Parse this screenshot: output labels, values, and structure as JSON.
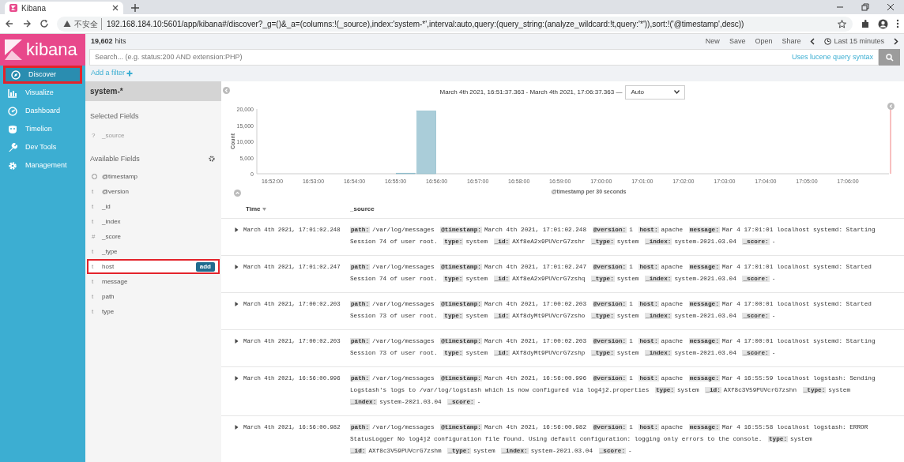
{
  "browser": {
    "tab_title": "Kibana",
    "security": "不安全",
    "url": "192.168.184.10:5601/app/kibana#/discover?_g=()&_a=(columns:!(_source),index:'system-*',interval:auto,query:(query_string:(analyze_wildcard:!t,query:'*')),sort:!('@timestamp',desc))"
  },
  "logo": "kibana",
  "nav": [
    {
      "label": "Discover",
      "selected": true,
      "highlighted": true
    },
    {
      "label": "Visualize",
      "selected": false,
      "highlighted": false
    },
    {
      "label": "Dashboard",
      "selected": false,
      "highlighted": false
    },
    {
      "label": "Timelion",
      "selected": false,
      "highlighted": false
    },
    {
      "label": "Dev Tools",
      "selected": false,
      "highlighted": false
    },
    {
      "label": "Management",
      "selected": false,
      "highlighted": false
    }
  ],
  "hits": "19,602",
  "hits_label": "hits",
  "menu": [
    "New",
    "Save",
    "Open",
    "Share"
  ],
  "time_range": "Last 15 minutes",
  "search": {
    "placeholder": "Search... (e.g. status:200 AND extension:PHP)",
    "syntax_link": "Uses lucene query syntax"
  },
  "add_filter": "Add a filter",
  "index_pattern": "system-*",
  "selected_fields_title": "Selected Fields",
  "selected_fields": [
    {
      "symbol": "?",
      "name": "_source"
    }
  ],
  "available_fields_title": "Available Fields",
  "available_fields": [
    {
      "name": "@timestamp",
      "highlighted": false
    },
    {
      "symbol": "t",
      "name": "@version",
      "highlighted": false
    },
    {
      "symbol": "t",
      "name": "_id",
      "highlighted": false
    },
    {
      "symbol": "t",
      "name": "_index",
      "highlighted": false
    },
    {
      "symbol": "#",
      "name": "_score",
      "highlighted": false
    },
    {
      "symbol": "t",
      "name": "_type",
      "highlighted": false
    },
    {
      "symbol": "t",
      "name": "host",
      "highlighted": true,
      "button": "add"
    },
    {
      "symbol": "t",
      "name": "message",
      "highlighted": false
    },
    {
      "symbol": "t",
      "name": "path",
      "highlighted": false
    },
    {
      "symbol": "t",
      "name": "type",
      "highlighted": false
    }
  ],
  "time_header": "March 4th 2021, 16:51:37.363 - March 4th 2021, 17:06:37.363 —",
  "interval": "Auto",
  "chart_data": {
    "type": "bar",
    "ylabel": "Count",
    "xlabel": "@timestamp per 30 seconds",
    "categories": [
      null,
      "16:52:00",
      null,
      "16:53:00",
      null,
      "16:54:00",
      null,
      "16:55:00",
      null,
      "16:56:00",
      null,
      "16:57:00",
      null,
      "16:58:00",
      null,
      "16:59:00",
      null,
      "17:00:00",
      null,
      "17:01:00",
      null,
      "17:02:00",
      null,
      "17:03:00",
      null,
      "17:04:00",
      null,
      "17:05:00",
      null,
      "17:06:00",
      null
    ],
    "values": [
      0,
      0,
      0,
      0,
      0,
      0,
      0,
      200,
      19400,
      0,
      0,
      0,
      0,
      0,
      0,
      0,
      0,
      0,
      0,
      0,
      0,
      0,
      0,
      0,
      0,
      0,
      0,
      0,
      0,
      0,
      0
    ],
    "ylim": [
      0,
      20000
    ],
    "yticks": [
      {
        "value": 0,
        "label": "0"
      },
      {
        "value": 5000,
        "label": "5,000"
      },
      {
        "value": 10000,
        "label": "10,000"
      },
      {
        "value": 15000,
        "label": "15,000"
      },
      {
        "value": 20000,
        "label": "20,000"
      }
    ]
  },
  "columns": [
    "Time",
    "_source"
  ],
  "rows": [
    {
      "time": "March 4th 2021, 17:01:02.248",
      "source": [
        {
          "key": "path:",
          "value": "/var/log/messages"
        },
        {
          "key": "@timestamp:",
          "value": "March 4th 2021, 17:01:02.248"
        },
        {
          "key": "@version:",
          "value": "1"
        },
        {
          "key": "host:",
          "value": "apache"
        },
        {
          "key": "message:",
          "value": "Mar 4 17:01:01 localhost systemd: Starting Session 74 of user root."
        },
        {
          "key": "type:",
          "value": "system"
        },
        {
          "key": "_id:",
          "value": "AXf8eA2x9PUVcrG7zshr"
        },
        {
          "key": "_type:",
          "value": "system"
        },
        {
          "key": "_index:",
          "value": "system-2021.03.04"
        },
        {
          "key": "_score:",
          "value": "-"
        }
      ]
    },
    {
      "time": "March 4th 2021, 17:01:02.247",
      "source": [
        {
          "key": "path:",
          "value": "/var/log/messages"
        },
        {
          "key": "@timestamp:",
          "value": "March 4th 2021, 17:01:02.247"
        },
        {
          "key": "@version:",
          "value": "1"
        },
        {
          "key": "host:",
          "value": "apache"
        },
        {
          "key": "message:",
          "value": "Mar 4 17:01:01 localhost systemd: Started Session 74 of user root."
        },
        {
          "key": "type:",
          "value": "system"
        },
        {
          "key": "_id:",
          "value": "AXf8eA2x9PUVcrG7zshq"
        },
        {
          "key": "_type:",
          "value": "system"
        },
        {
          "key": "_index:",
          "value": "system-2021.03.04"
        },
        {
          "key": "_score:",
          "value": "-"
        }
      ]
    },
    {
      "time": "March 4th 2021, 17:00:02.203",
      "source": [
        {
          "key": "path:",
          "value": "/var/log/messages"
        },
        {
          "key": "@timestamp:",
          "value": "March 4th 2021, 17:00:02.203"
        },
        {
          "key": "@version:",
          "value": "1"
        },
        {
          "key": "host:",
          "value": "apache"
        },
        {
          "key": "message:",
          "value": "Mar 4 17:00:01 localhost systemd: Started Session 73 of user root."
        },
        {
          "key": "type:",
          "value": "system"
        },
        {
          "key": "_id:",
          "value": "AXf8dyMt9PUVcrG7zsho"
        },
        {
          "key": "_type:",
          "value": "system"
        },
        {
          "key": "_index:",
          "value": "system-2021.03.04"
        },
        {
          "key": "_score:",
          "value": "-"
        }
      ]
    },
    {
      "time": "March 4th 2021, 17:00:02.203",
      "source": [
        {
          "key": "path:",
          "value": "/var/log/messages"
        },
        {
          "key": "@timestamp:",
          "value": "March 4th 2021, 17:00:02.203"
        },
        {
          "key": "@version:",
          "value": "1"
        },
        {
          "key": "host:",
          "value": "apache"
        },
        {
          "key": "message:",
          "value": "Mar 4 17:00:01 localhost systemd: Starting Session 73 of user root."
        },
        {
          "key": "type:",
          "value": "system"
        },
        {
          "key": "_id:",
          "value": "AXf8dyMt9PUVcrG7zshp"
        },
        {
          "key": "_type:",
          "value": "system"
        },
        {
          "key": "_index:",
          "value": "system-2021.03.04"
        },
        {
          "key": "_score:",
          "value": "-"
        }
      ]
    },
    {
      "time": "March 4th 2021, 16:56:00.996",
      "source": [
        {
          "key": "path:",
          "value": "/var/log/messages"
        },
        {
          "key": "@timestamp:",
          "value": "March 4th 2021, 16:56:00.996"
        },
        {
          "key": "@version:",
          "value": "1"
        },
        {
          "key": "host:",
          "value": "apache"
        },
        {
          "key": "message:",
          "value": "Mar 4 16:55:59 localhost logstash: Sending Logstash's logs to /var/log/logstash which is now configured via log4j2.properties"
        },
        {
          "key": "type:",
          "value": "system"
        },
        {
          "key": "_id:",
          "value": "AXf8c3V59PUVcrG7zshn"
        },
        {
          "key": "_type:",
          "value": "system"
        },
        {
          "key": "_index:",
          "value": "system-2021.03.04"
        },
        {
          "key": "_score:",
          "value": "-"
        }
      ]
    },
    {
      "time": "March 4th 2021, 16:56:00.982",
      "source": [
        {
          "key": "path:",
          "value": "/var/log/messages"
        },
        {
          "key": "@timestamp:",
          "value": "March 4th 2021, 16:56:00.982"
        },
        {
          "key": "@version:",
          "value": "1"
        },
        {
          "key": "host:",
          "value": "apache"
        },
        {
          "key": "message:",
          "value": "Mar 4 16:55:58 localhost logstash: ERROR StatusLogger No log4j2 configuration file found. Using default configuration: logging only errors to the console."
        },
        {
          "key": "type:",
          "value": "system"
        },
        {
          "key": "_id:",
          "value": "AXf8c3V59PUVcrG7zshm"
        },
        {
          "key": "_type:",
          "value": "system"
        },
        {
          "key": "_index:",
          "value": "system-2021.03.04"
        },
        {
          "key": "_score:",
          "value": "-"
        }
      ]
    }
  ]
}
